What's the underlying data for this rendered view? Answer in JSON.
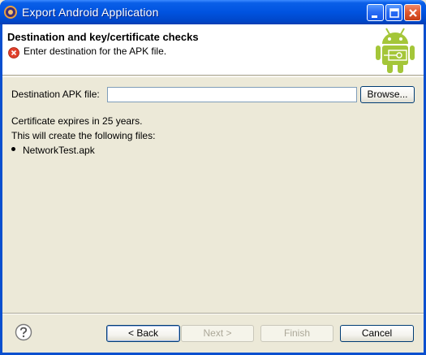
{
  "window": {
    "title": "Export Android Application",
    "minimize_icon": "minimize-icon",
    "maximize_icon": "maximize-icon",
    "close_icon": "close-icon"
  },
  "header": {
    "title": "Destination and key/certificate checks",
    "message": "Enter destination for the APK file.",
    "message_icon": "error-icon",
    "logo": "android-robot-icon"
  },
  "form": {
    "destination_label": "Destination APK file:",
    "destination_value": "",
    "browse_label": "Browse..."
  },
  "info": {
    "certificate": "Certificate expires in 25 years.",
    "files_heading": "This will create the following files:",
    "files": [
      "NetworkTest.apk"
    ]
  },
  "footer": {
    "help_icon": "help-icon",
    "back_label": "< Back",
    "next_label": "Next >",
    "finish_label": "Finish",
    "cancel_label": "Cancel"
  },
  "colors": {
    "titlebar": "#0053e0",
    "dialog_bg": "#ece9d8",
    "android_green": "#a4c639",
    "error_red": "#e0402b"
  }
}
